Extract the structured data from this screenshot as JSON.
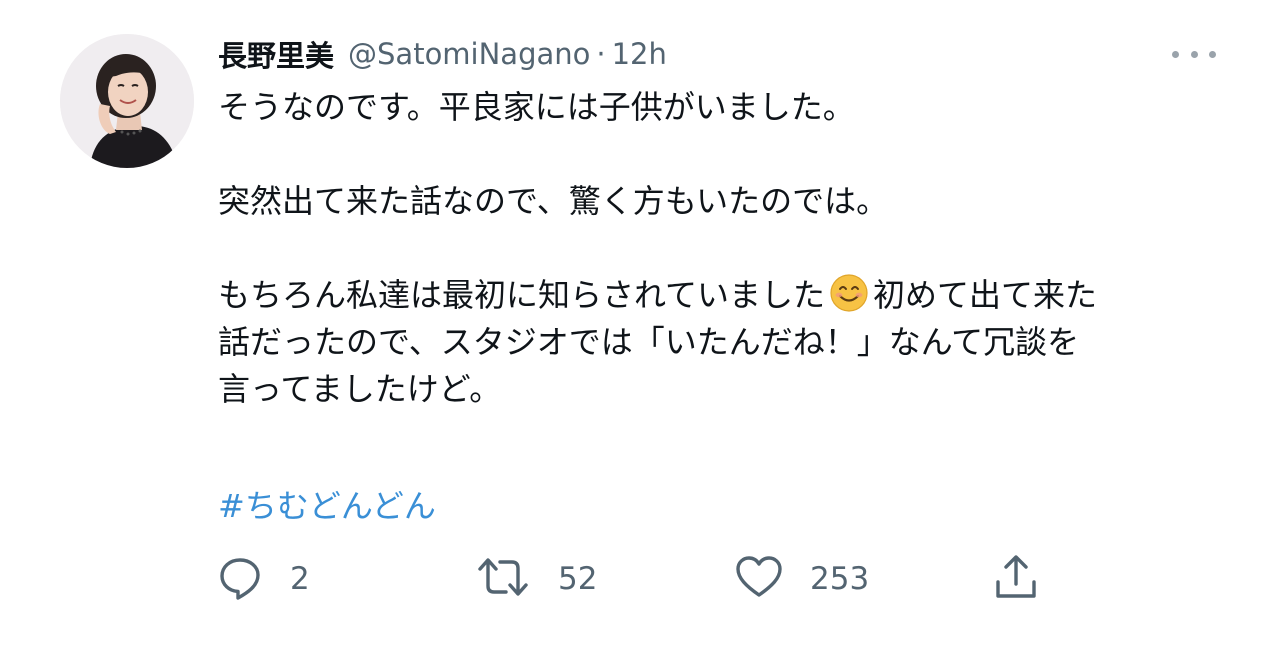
{
  "tweet": {
    "author_name": "長野里美",
    "handle": "@SatomiNagano",
    "separator": "·",
    "time": "12h",
    "body_lines": [
      "そうなのです。平良家には子供がいました。",
      "突然出て来た話なので、驚く方もいたのでは。",
      "もちろん私達は最初に知らされていました",
      "初めて出て来た",
      "話だったので、スタジオでは「いたんだね！」なんて冗談を",
      "言ってましたけど。"
    ],
    "hashtag": "#ちむどんどん",
    "emoji": "smiling-face-emoji"
  },
  "actions": {
    "reply": {
      "icon": "comment-icon",
      "count": "2"
    },
    "retweet": {
      "icon": "retweet-icon",
      "count": "52"
    },
    "like": {
      "icon": "heart-icon",
      "count": "253"
    },
    "share": {
      "icon": "share-icon"
    }
  },
  "colors": {
    "text": "#0f1419",
    "secondary": "#536471",
    "hashtag": "#3a8fd6",
    "emoji": "#f7c244"
  }
}
